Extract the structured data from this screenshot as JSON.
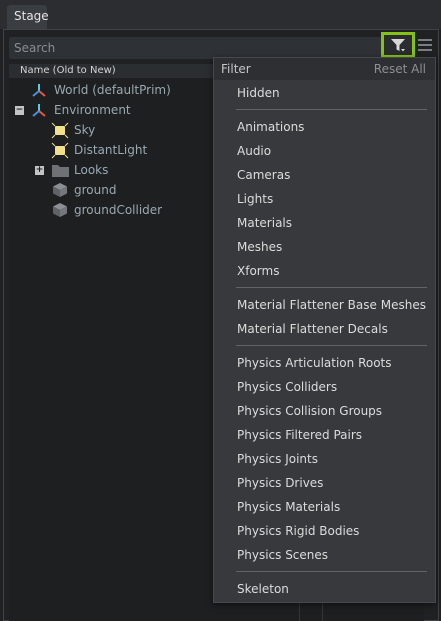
{
  "tab": {
    "label": "Stage"
  },
  "search": {
    "placeholder": "Search"
  },
  "tree": {
    "column_header": "Name (Old to New)",
    "rows": [
      {
        "label": "World (defaultPrim)",
        "icon": "xform-axis-icon"
      },
      {
        "label": "Environment",
        "icon": "xform-axis-icon",
        "expander": "−"
      },
      {
        "label": "Sky",
        "icon": "light-bulb-icon"
      },
      {
        "label": "DistantLight",
        "icon": "light-bulb-icon"
      },
      {
        "label": "Looks",
        "icon": "folder-icon",
        "expander": "+"
      },
      {
        "label": "ground",
        "icon": "mesh-cube-icon"
      },
      {
        "label": "groundCollider",
        "icon": "mesh-cube-icon"
      }
    ]
  },
  "filter_menu": {
    "title": "Filter",
    "reset": "Reset All",
    "items": [
      "Hidden",
      "Animations",
      "Audio",
      "Cameras",
      "Lights",
      "Materials",
      "Meshes",
      "Xforms",
      "Material Flattener Base Meshes",
      "Material Flattener Decals",
      "Physics Articulation Roots",
      "Physics Colliders",
      "Physics Collision Groups",
      "Physics Filtered Pairs",
      "Physics Joints",
      "Physics Drives",
      "Physics Materials",
      "Physics Rigid Bodies",
      "Physics Scenes",
      "Skeleton"
    ]
  },
  "colors": {
    "accent_green": "#84c218",
    "tree_text": "#9aa9b1",
    "menu_bg": "#37393c"
  }
}
